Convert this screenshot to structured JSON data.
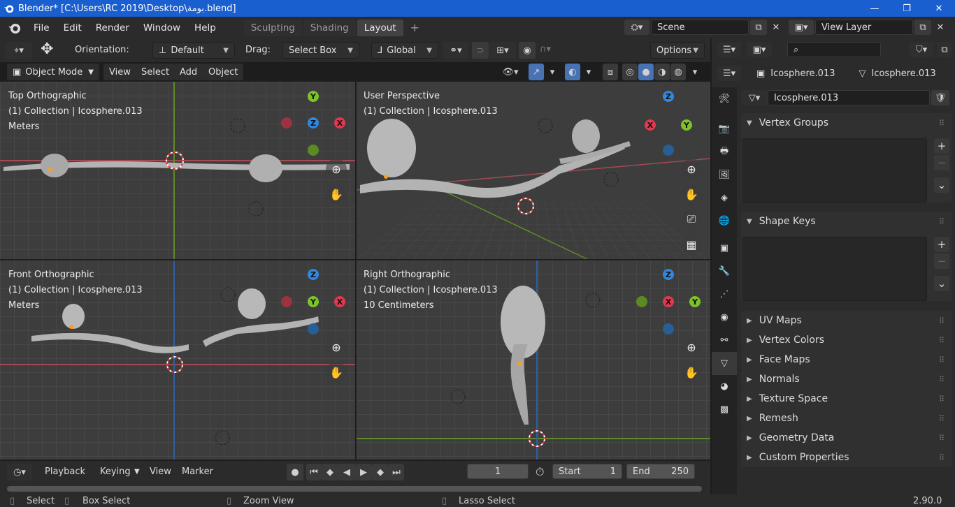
{
  "window": {
    "title": "Blender* [C:\\Users\\RC 2019\\Desktop\\بومة.blend]",
    "minimize": "—",
    "maximize": "❐",
    "close": "✕"
  },
  "menu": {
    "file": "File",
    "edit": "Edit",
    "render": "Render",
    "window": "Window",
    "help": "Help"
  },
  "workspaces": {
    "sculpting": "Sculpting",
    "shading": "Shading",
    "layout": "Layout",
    "add": "+"
  },
  "scene": {
    "name": "Scene",
    "view_layer": "View Layer"
  },
  "toolbar": {
    "orientation_label": "Orientation:",
    "orientation_value": "Default",
    "drag_label": "Drag:",
    "drag_value": "Select Box",
    "transform_orientation": "Global",
    "options": "Options"
  },
  "header2": {
    "mode": "Object Mode",
    "view": "View",
    "select": "Select",
    "add": "Add",
    "object": "Object"
  },
  "viewports": {
    "top": {
      "name": "Top Orthographic",
      "collection": "(1) Collection | Icosphere.013",
      "units": "Meters"
    },
    "user": {
      "name": "User Perspective",
      "collection": "(1) Collection | Icosphere.013"
    },
    "front": {
      "name": "Front Orthographic",
      "collection": "(1) Collection | Icosphere.013",
      "units": "Meters"
    },
    "right": {
      "name": "Right Orthographic",
      "collection": "(1) Collection | Icosphere.013",
      "units": "10 Centimeters"
    }
  },
  "axes": {
    "x": "X",
    "y": "Y",
    "z": "Z"
  },
  "props": {
    "object_name": "Icosphere.013",
    "mesh_name": "Icosphere.013",
    "data_name": "Icosphere.013",
    "panels": {
      "vertex_groups": "Vertex Groups",
      "shape_keys": "Shape Keys",
      "uv_maps": "UV Maps",
      "vertex_colors": "Vertex Colors",
      "face_maps": "Face Maps",
      "normals": "Normals",
      "texture_space": "Texture Space",
      "remesh": "Remesh",
      "geometry_data": "Geometry Data",
      "custom_properties": "Custom Properties"
    }
  },
  "timeline": {
    "playback": "Playback",
    "keying": "Keying",
    "view": "View",
    "marker": "Marker",
    "current_frame": "1",
    "start_label": "Start",
    "start": "1",
    "end_label": "End",
    "end": "250"
  },
  "status": {
    "select": "Select",
    "box_select": "Box Select",
    "zoom_view": "Zoom View",
    "lasso_select": "Lasso Select",
    "version": "2.90.0"
  },
  "colors": {
    "titlebar": "#1a5fd0",
    "x_axis": "#e0384f",
    "y_axis": "#7ec22a",
    "z_axis": "#2f87e0",
    "active_tab": "#3a3a3a"
  }
}
